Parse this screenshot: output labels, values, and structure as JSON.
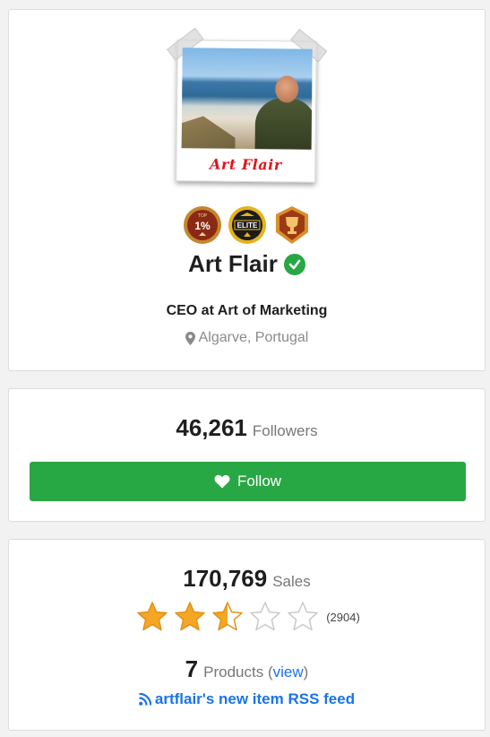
{
  "profile": {
    "photo_caption": "Art Flair",
    "badges": [
      {
        "name": "top-1-percent",
        "label": "1%",
        "small": "TOP"
      },
      {
        "name": "elite",
        "label": "ELITE"
      },
      {
        "name": "trophy"
      }
    ],
    "name": "Art Flair",
    "verified": true,
    "title": "CEO at Art of Marketing",
    "location": "Algarve, Portugal"
  },
  "followers": {
    "count": "46,261",
    "label": "Followers",
    "follow_button": "Follow"
  },
  "sales": {
    "count": "170,769",
    "label": "Sales",
    "rating": 2.5,
    "max_rating": 5,
    "review_count": "(2904)",
    "products_count": "7",
    "products_label": "Products (",
    "products_link": "view",
    "products_close": ")",
    "rss_text": "artflair's new item RSS feed"
  },
  "colors": {
    "green": "#28a745",
    "link_blue": "#1a73e8",
    "caption_red": "#e0141b",
    "star_gold": "#f5a623"
  }
}
